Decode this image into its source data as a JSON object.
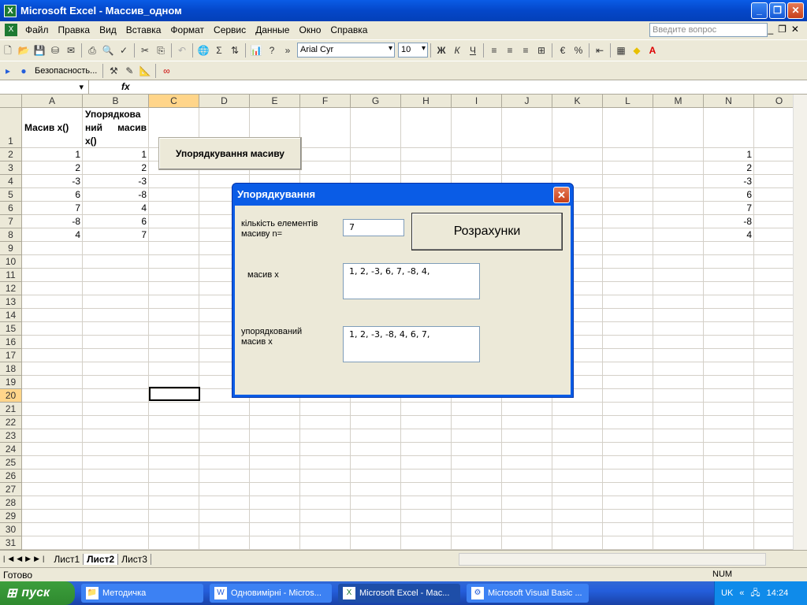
{
  "window": {
    "title": "Microsoft Excel - Массив_одном"
  },
  "menu": {
    "items": [
      "Файл",
      "Правка",
      "Вид",
      "Вставка",
      "Формат",
      "Сервис",
      "Данные",
      "Окно",
      "Справка"
    ],
    "help_placeholder": "Введите вопрос"
  },
  "toolbar": {
    "font": "Arial Cyr",
    "size": "10",
    "bold": "Ж",
    "italic": "К",
    "underline": "Ч",
    "percent": "%",
    "sigma": "Σ",
    "security": "Безопасность..."
  },
  "formula": {
    "fx": "fx"
  },
  "grid": {
    "columns": [
      "A",
      "B",
      "C",
      "D",
      "E",
      "F",
      "G",
      "H",
      "I",
      "J",
      "K",
      "L",
      "M",
      "N",
      "O"
    ],
    "rows": [
      "1",
      "2",
      "3",
      "4",
      "5",
      "6",
      "7",
      "8",
      "9",
      "10",
      "11",
      "12",
      "13",
      "14",
      "15",
      "16",
      "17",
      "18",
      "19",
      "20",
      "21",
      "22",
      "23",
      "24",
      "25",
      "26",
      "27",
      "28",
      "29",
      "30",
      "31"
    ],
    "a1": "Масив x()",
    "b1": [
      "Упорядкова",
      "ний масив",
      "x()"
    ],
    "col_a": [
      "1",
      "2",
      "-3",
      "6",
      "7",
      "-8",
      "4"
    ],
    "col_b": [
      "1",
      "2",
      "-3",
      "-8",
      "4",
      "6",
      "7"
    ],
    "col_n": [
      "1",
      "2",
      "-3",
      "6",
      "7",
      "-8",
      "4"
    ],
    "sheet_button": "Упорядкування масиву"
  },
  "dialog": {
    "title": "Упорядкування",
    "n_label": [
      "кількість елементів",
      "масиву  n="
    ],
    "n_value": "7",
    "calc_button": "Розрахунки",
    "array_label": "масив  x",
    "array_value": "1, 2, -3, 6, 7, -8, 4,",
    "sorted_label": [
      "упорядкований",
      "масив x"
    ],
    "sorted_value": "1, 2, -3, -8, 4, 6, 7,"
  },
  "sheets": {
    "tabs": [
      "Лист1",
      "Лист2",
      "Лист3"
    ],
    "active": "Лист2"
  },
  "status": {
    "ready": "Готово",
    "num": "NUM"
  },
  "taskbar": {
    "start": "пуск",
    "tasks": [
      "Методичка",
      "Одновимірні - Micros...",
      "Microsoft Excel - Мас...",
      "Microsoft Visual Basic ..."
    ],
    "lang": "UK",
    "clock": "14:24"
  }
}
